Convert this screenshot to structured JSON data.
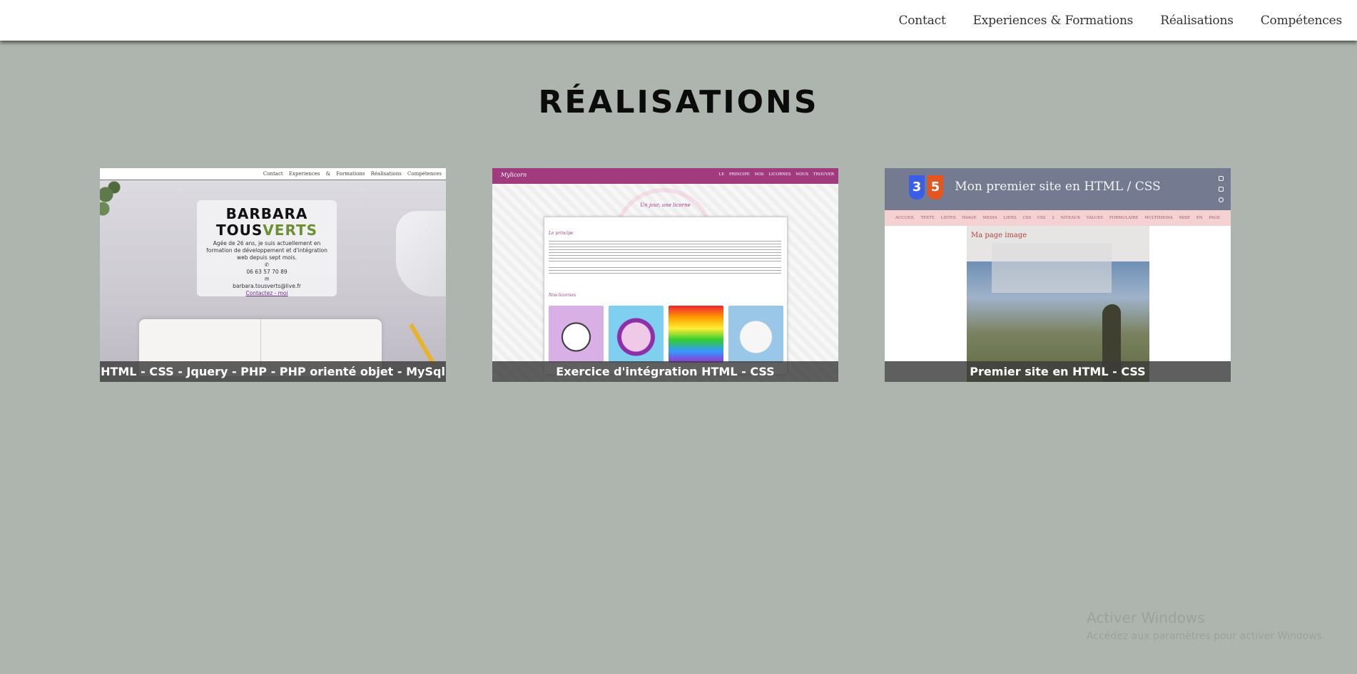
{
  "nav": {
    "contact": "Contact",
    "experiences": "Experiences & Formations",
    "realisations": "Réalisations",
    "competences": "Compétences"
  },
  "page": {
    "title": "RÉALISATIONS"
  },
  "projects": [
    {
      "caption": "HTML - CSS - Jquery - PHP - PHP orienté objet - MySql",
      "preview": {
        "nav": "Contact   Experiences & Formations   Réalisations   Compétences",
        "name_line1": "BARBARA",
        "name_line2_a": "TOUS",
        "name_line2_b": "VERTS",
        "intro": "Agée de 26 ans, je suis actuellement en formation de développement et d'intégration web depuis sept mois.",
        "phone_icon": "phone-icon",
        "phone": "06 63 57 70 89",
        "mail_icon": "mail-icon",
        "email": "barbara.tousverts@live.fr",
        "contact_link": "Contactez - moi"
      }
    },
    {
      "caption": "Exercice d'intégration HTML - CSS",
      "preview": {
        "logo": "Mylicorn",
        "links": "LE PRINCIPE   NOS LICORNES   NOUS TROUVER",
        "subtitle": "Un jour, une licorne",
        "section1": "Le principe",
        "section2": "Nos licornes"
      }
    },
    {
      "caption": "Premier site en HTML - CSS",
      "preview": {
        "title": "Mon premier site en HTML / CSS",
        "badge_css": "3",
        "badge_html": "5",
        "menu": "ACCUEIL   TEXTE   LISTES   IMAGE   MEDIA   LIENS   CSS   CSS 2 NIVEAUX   VALUES   FORMULAIRE   MULTIMEDIA   MISE EN PAGE",
        "page_heading": "Ma page image"
      }
    }
  ],
  "watermark": {
    "line1": "Activer Windows",
    "line2": "Accédez aux paramètres pour activer Windows."
  }
}
